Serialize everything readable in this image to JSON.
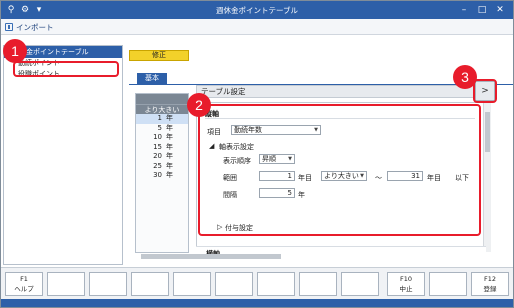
{
  "window": {
    "title": "週休金ポイントテーブル"
  },
  "toolbar": {
    "import_label": "インポート"
  },
  "tree": {
    "header": "金ポイントテーブル",
    "items": [
      "勤続ポイント",
      "役職ポイント"
    ]
  },
  "mode_badge": "修正",
  "tab": {
    "label": "基本"
  },
  "mini_table": {
    "header": "より大きい",
    "rows": [
      {
        "n": "1",
        "unit": "年"
      },
      {
        "n": "5",
        "unit": "年"
      },
      {
        "n": "10",
        "unit": "年"
      },
      {
        "n": "15",
        "unit": "年"
      },
      {
        "n": "20",
        "unit": "年"
      },
      {
        "n": "25",
        "unit": "年"
      },
      {
        "n": "30",
        "unit": "年"
      }
    ]
  },
  "panel": {
    "title": "テーブル設定",
    "expand_glyph": ">",
    "section_title": "縦軸",
    "item_label": "項目",
    "item_value": "勤続年数",
    "axis_label": "軸表示設定",
    "order_label": "表示順序",
    "order_value": "昇順",
    "range_label": "範囲",
    "range_from": "1",
    "range_unit1": "年目",
    "range_cond": "より大きい",
    "range_tilde": "～",
    "range_to": "31",
    "range_unit2": "年目",
    "range_suffix": "以下",
    "interval_label": "間隔",
    "interval_value": "5",
    "interval_unit": "年",
    "grant_label": "付与設定",
    "next_section": "横軸"
  },
  "fkeys": [
    {
      "key": "F1",
      "label": "ヘルプ"
    },
    {
      "key": "",
      "label": ""
    },
    {
      "key": "",
      "label": ""
    },
    {
      "key": "",
      "label": ""
    },
    {
      "key": "",
      "label": ""
    },
    {
      "key": "",
      "label": ""
    },
    {
      "key": "",
      "label": ""
    },
    {
      "key": "",
      "label": ""
    },
    {
      "key": "",
      "label": ""
    },
    {
      "key": "F10",
      "label": "中止"
    },
    {
      "key": "",
      "label": ""
    },
    {
      "key": "F12",
      "label": "登録"
    }
  ],
  "callouts": [
    "1",
    "2",
    "3"
  ]
}
